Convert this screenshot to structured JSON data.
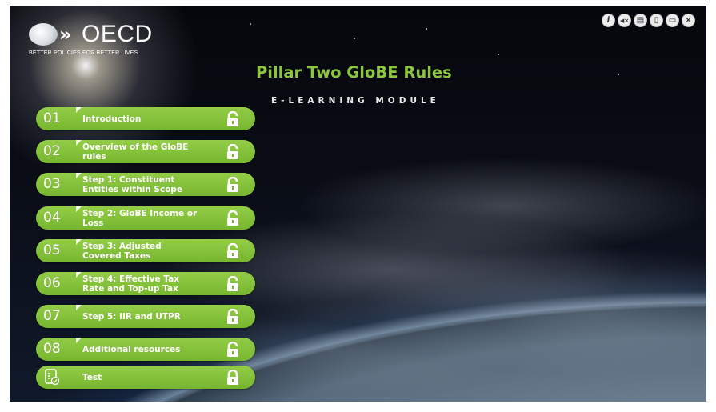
{
  "logo": {
    "name": "OECD",
    "tagline": "BETTER POLICIES FOR BETTER LIVES"
  },
  "toolbar": [
    {
      "icon": "info-icon",
      "glyph": "i"
    },
    {
      "icon": "audio-icon",
      "glyph": "◀×"
    },
    {
      "icon": "transcript-icon",
      "glyph": "▤"
    },
    {
      "icon": "document-icon",
      "glyph": "▯"
    },
    {
      "icon": "folder-icon",
      "glyph": "▭"
    },
    {
      "icon": "close-icon",
      "glyph": "×"
    }
  ],
  "header": {
    "title": "Pillar Two GloBE Rules",
    "subtitle": "E-LEARNING MODULE"
  },
  "menu": [
    {
      "num": "01",
      "label": "Introduction"
    },
    {
      "num": "02",
      "label": "Overview of the GloBE rules"
    },
    {
      "num": "03",
      "label": "Step 1: Constituent Entities within Scope"
    },
    {
      "num": "04",
      "label": "Step 2: GloBE Income or Loss"
    },
    {
      "num": "05",
      "label": "Step 3: Adjusted Covered Taxes"
    },
    {
      "num": "06",
      "label": "Step 4: Effective Tax Rate and Top-up Tax"
    },
    {
      "num": "07",
      "label": "Step 5: IIR and UTPR"
    },
    {
      "num": "08",
      "label": "Additional resources"
    },
    {
      "num": "",
      "label": "Test",
      "icon": "test-icon"
    }
  ],
  "colors": {
    "accent_green": "#8cc63f",
    "button_green": "#76b62e"
  }
}
